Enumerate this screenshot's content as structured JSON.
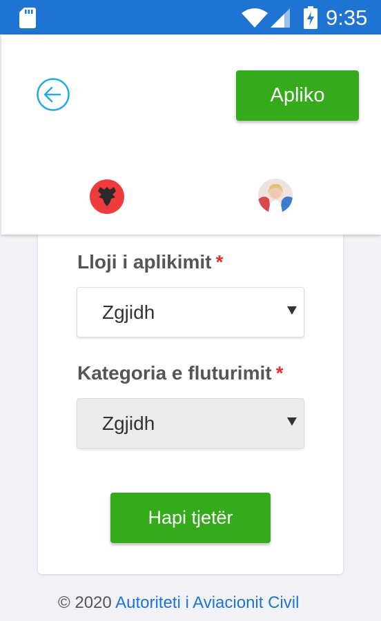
{
  "status_bar": {
    "time": "9:35",
    "icons": [
      "sd-card-icon",
      "wifi-icon",
      "signal-icon",
      "battery-charging-icon"
    ]
  },
  "header": {
    "back_icon": "arrow-left-circle-icon",
    "apply_label": "Apliko",
    "language_flag_icon": "albanian-flag-icon",
    "avatar_icon": "user-avatar"
  },
  "form": {
    "application_type": {
      "label": "Lloji i aplikimit",
      "required_mark": "*",
      "selected": "Zgjidh"
    },
    "flight_category": {
      "label": "Kategoria e fluturimit",
      "required_mark": "*",
      "selected": "Zgjidh"
    },
    "next_label": "Hapi tjetër"
  },
  "footer": {
    "copyright": "© 2020",
    "link_text": "Autoriteti i Aviacionit Civil"
  },
  "colors": {
    "status_bar": "#1e74d0",
    "primary_green": "#35ab1b",
    "required_red": "#e33030",
    "link_blue": "#1e74d0",
    "page_background": "#f1f2f7"
  }
}
